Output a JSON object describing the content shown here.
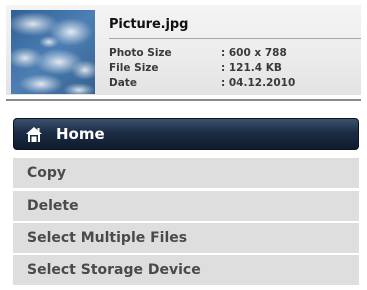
{
  "file": {
    "name": "Picture.jpg",
    "thumbnail_icon": "sky-photo-thumbnail",
    "properties": [
      {
        "label": "Photo Size",
        "value": ": 600 x 788"
      },
      {
        "label": "File Size",
        "value": ": 121.4 KB"
      },
      {
        "label": "Date",
        "value": ": 04.12.2010"
      }
    ]
  },
  "menu": {
    "home": {
      "label": "Home",
      "icon": "home-icon"
    },
    "items": [
      {
        "label": "Copy"
      },
      {
        "label": "Delete"
      },
      {
        "label": "Select Multiple Files"
      },
      {
        "label": "Select Storage Device"
      }
    ]
  },
  "colors": {
    "home_bar": "#1c2c44",
    "menu_item_bg": "#dedede",
    "menu_item_text": "#4a4a4a"
  }
}
